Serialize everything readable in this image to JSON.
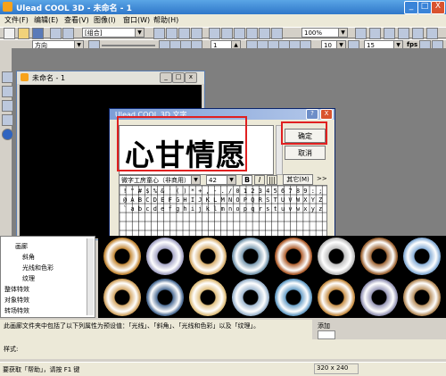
{
  "window": {
    "title": "Ulead COOL 3D - 未命名 - 1",
    "min": "_",
    "max": "□",
    "close": "X"
  },
  "menu": [
    "文件(F)",
    "编辑(E)",
    "查看(V)",
    "图像(I)",
    "窗口(W)",
    "帮助(H)"
  ],
  "toolbar1": {
    "object_combo": "[组合]",
    "zoom": "100%"
  },
  "toolbar2": {
    "direction_combo": "方向",
    "frame_value": "1",
    "fps_value": "10",
    "fps2_value": "15",
    "fps_label": "fps"
  },
  "doc_window": {
    "title": "未命名 - 1"
  },
  "text_dialog": {
    "title": "Ulead COOL 3D 文字",
    "text": "心甘情愿",
    "ok_label": "确定",
    "cancel_label": "取消",
    "font_combo": "微字工房童心（非商用）",
    "size_value": "42",
    "bold_label": "B",
    "italic_label": "I",
    "other_label": "其它(M)",
    "more_label": ">>",
    "char_rows": [
      "! \" # $ % & ' ( ) * + , - . / 0 1 2 3 4 5 6 7 8 9 : ; < = > ?",
      "@ A B C D E F G H I J K L M N O P Q R S T U V W X Y Z [ \\ ] ^ _",
      "` a b c d e f g h i j k l m n o p q r s t u v w x y z { | } ~"
    ],
    "help_label": "?",
    "close_label": "X"
  },
  "tree": {
    "items": [
      "画廊",
      "斜角",
      "光线和色彩",
      "纹理",
      "整体特效",
      "对象特效",
      "转场特效"
    ]
  },
  "description": "此画廊文件夹中包括了以下列属性为预设值：「光线」、「斜角」、「光线和色彩」以及「纹理」。",
  "add_label": "添加",
  "style_label": "样式:",
  "status": {
    "help_text": "要获取「帮助」，请按 F1 键",
    "dimensions": "320 x 240"
  },
  "colors": {
    "annotation": "#e02020",
    "title_blue": "#2f77c9",
    "canvas": "#000000"
  },
  "thumb_colors": [
    "#c48a3a",
    "#a8a8c8",
    "#d8b070",
    "#7a9ab0",
    "#b06030",
    "#c0c0c0",
    "#a06838",
    "#8ab0d8",
    "#d4a868",
    "#507098",
    "#e0c080",
    "#a0b8d0",
    "#6aa0c8",
    "#c89048",
    "#9898b8",
    "#b89060"
  ]
}
